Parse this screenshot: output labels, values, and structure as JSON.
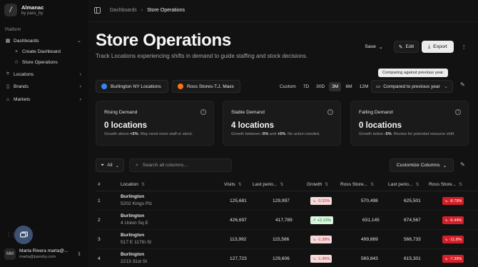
{
  "app": {
    "name": "Almanac",
    "byline": "by pass_by",
    "logo": "/"
  },
  "sidebar": {
    "section": "Platform",
    "items": [
      {
        "label": "Dashboards",
        "icon": "grid-icon"
      },
      {
        "label": "Create Dashboard",
        "icon": "plus-icon"
      },
      {
        "label": "Store Operations",
        "icon": "star-icon"
      },
      {
        "label": "Locations",
        "icon": "pin-icon"
      },
      {
        "label": "Brands",
        "icon": "bookmark-icon"
      },
      {
        "label": "Markets",
        "icon": "store-icon"
      }
    ]
  },
  "user": {
    "initials": "MM",
    "name": "Marta Rivera marta@...",
    "email": "marta@passby.com"
  },
  "breadcrumb": {
    "parent": "Dashboards",
    "current": "Store Operations"
  },
  "page": {
    "title": "Store Operations",
    "subtitle": "Track Locations experiencing shifts in demand to guide staffing and stock decisions."
  },
  "actions": {
    "save": "Save",
    "edit": "Edit",
    "export": "Export"
  },
  "tooltip": "Comparing against previous year.",
  "chips": [
    {
      "label": "Burlington NY Locations",
      "color": "#3b82f6"
    },
    {
      "label": "Ross Stores-T.J. Maxx",
      "color": "#f97316"
    }
  ],
  "ranges": [
    "Custom",
    "7D",
    "30D",
    "3M",
    "6M",
    "12M"
  ],
  "active_range": "3M",
  "compare": "Compared to previous year",
  "cards": [
    {
      "title": "Rising Demand",
      "value": "0 locations",
      "pre": "Growth above ",
      "strong": "+5%",
      "post": ". May need more staff or stock."
    },
    {
      "title": "Stable Demand",
      "value": "4 locations",
      "pre": "Growth between ",
      "strong": "-5%",
      "mid": " and ",
      "strong2": "+5%",
      "post": ". No action needed."
    },
    {
      "title": "Falling Demand",
      "value": "0 locations",
      "pre": "Growth below ",
      "strong": "-5%",
      "post": ". Review for potential resource shift."
    }
  ],
  "filter": {
    "all": "All",
    "search_placeholder": "Search all columns..."
  },
  "customize": "Customize Columns",
  "table": {
    "headers": [
      "#",
      "Location",
      "Visits",
      "Last perio...",
      "Growth",
      "Ross Store...",
      "Last perio...",
      "Ross Store..."
    ],
    "rows": [
      {
        "n": "1",
        "name": "Burlington",
        "addr": "5202 Kings Plz",
        "visits": "125,681",
        "last": "129,997",
        "growth": "-3.32%",
        "growth_dir": "down",
        "ross": "570,498",
        "ross_last": "625,501",
        "ross_growth": "-8.79%"
      },
      {
        "n": "2",
        "name": "Burlington",
        "addr": "4 Union Sq E",
        "visits": "426,697",
        "last": "417,789",
        "growth": "+2.13%",
        "growth_dir": "up",
        "ross": "631,145",
        "ross_last": "674,567",
        "ross_growth": "-6.44%"
      },
      {
        "n": "3",
        "name": "Burlington",
        "addr": "517 E 117th St",
        "visits": "113,992",
        "last": "115,586",
        "growth": "-1.38%",
        "growth_dir": "down",
        "ross": "499,869",
        "ross_last": "566,733",
        "ross_growth": "-11.8%"
      },
      {
        "n": "4",
        "name": "Burlington",
        "addr": "2213 31st St",
        "visits": "127,723",
        "last": "129,606",
        "growth": "-1.45%",
        "growth_dir": "down",
        "ross": "569,843",
        "ross_last": "615,301",
        "ross_growth": "-7.39%"
      }
    ]
  }
}
